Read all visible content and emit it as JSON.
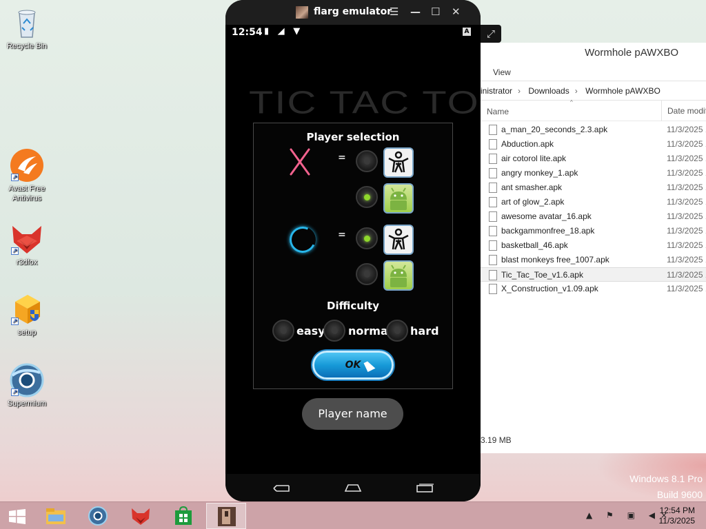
{
  "desktop": {
    "icons": [
      {
        "label": "Recycle Bin",
        "icon": "recycle-bin-icon"
      },
      {
        "label": "Avast Free Antivirus",
        "icon": "avast-icon"
      },
      {
        "label": "r3dfox",
        "icon": "r3dfox-icon"
      },
      {
        "label": "setup",
        "icon": "setup-icon"
      },
      {
        "label": "Supermium",
        "icon": "supermium-icon"
      }
    ],
    "watermark_line1": "Windows 8.1 Pro",
    "watermark_line2": "Build 9600"
  },
  "emulator": {
    "title": "flarg emulator",
    "controls": {
      "menu": "☰",
      "minimize": "—",
      "maximize": "☐",
      "close": "✕"
    },
    "expand_glyph": "⤢",
    "status_bar": {
      "time": "12:54",
      "icons": "▮ ◢ ▼",
      "badge": "A"
    }
  },
  "game": {
    "background_title": "TIC TAC TOE",
    "dialog": {
      "player_selection_title": "Player selection",
      "equals": "=",
      "players": [
        {
          "symbol": "X",
          "options": [
            {
              "type": "human",
              "selected": false
            },
            {
              "type": "android",
              "selected": true
            }
          ]
        },
        {
          "symbol": "O",
          "options": [
            {
              "type": "human",
              "selected": true
            },
            {
              "type": "android",
              "selected": false
            }
          ]
        }
      ],
      "difficulty_title": "Difficulty",
      "difficulty_options": [
        {
          "label": "easy",
          "selected": false
        },
        {
          "label": "normal",
          "selected": false
        },
        {
          "label": "hard",
          "selected": false
        }
      ],
      "ok_label": "OK"
    },
    "player_name_label": "Player name"
  },
  "explorer": {
    "title": "Wormhole pAWXBO",
    "ribbon_tab": "View",
    "breadcrumb": [
      "inistrator",
      "Downloads",
      "Wormhole pAWXBO"
    ],
    "breadcrumb_sep": "›",
    "columns": {
      "name": "Name",
      "date": "Date modif"
    },
    "files": [
      {
        "name": "a_man_20_seconds_2.3.apk",
        "date": "11/3/2025 1"
      },
      {
        "name": "Abduction.apk",
        "date": "11/3/2025 1"
      },
      {
        "name": "air cotorol lite.apk",
        "date": "11/3/2025 1"
      },
      {
        "name": "angry monkey_1.apk",
        "date": "11/3/2025 1"
      },
      {
        "name": "ant smasher.apk",
        "date": "11/3/2025 1"
      },
      {
        "name": "art of glow_2.apk",
        "date": "11/3/2025 1"
      },
      {
        "name": "awesome avatar_16.apk",
        "date": "11/3/2025 1"
      },
      {
        "name": "backgammonfree_18.apk",
        "date": "11/3/2025 1"
      },
      {
        "name": "basketball_46.apk",
        "date": "11/3/2025 1"
      },
      {
        "name": "blast monkeys free_1007.apk",
        "date": "11/3/2025 1"
      },
      {
        "name": "Tic_Tac_Toe_v1.6.apk",
        "date": "11/3/2025 1",
        "selected": true
      },
      {
        "name": "X_Construction_v1.09.apk",
        "date": "11/3/2025 1"
      }
    ],
    "status": "3.19 MB"
  },
  "taskbar": {
    "apps": [
      "file-explorer-icon",
      "supermium-icon",
      "r3dfox-icon",
      "store-icon",
      "flarg-emulator-icon"
    ],
    "active_app": "flarg-emulator-icon",
    "tray": "▲ ⚑ ▣ ◀×",
    "time": "12:54 PM",
    "date": "11/3/2025"
  }
}
